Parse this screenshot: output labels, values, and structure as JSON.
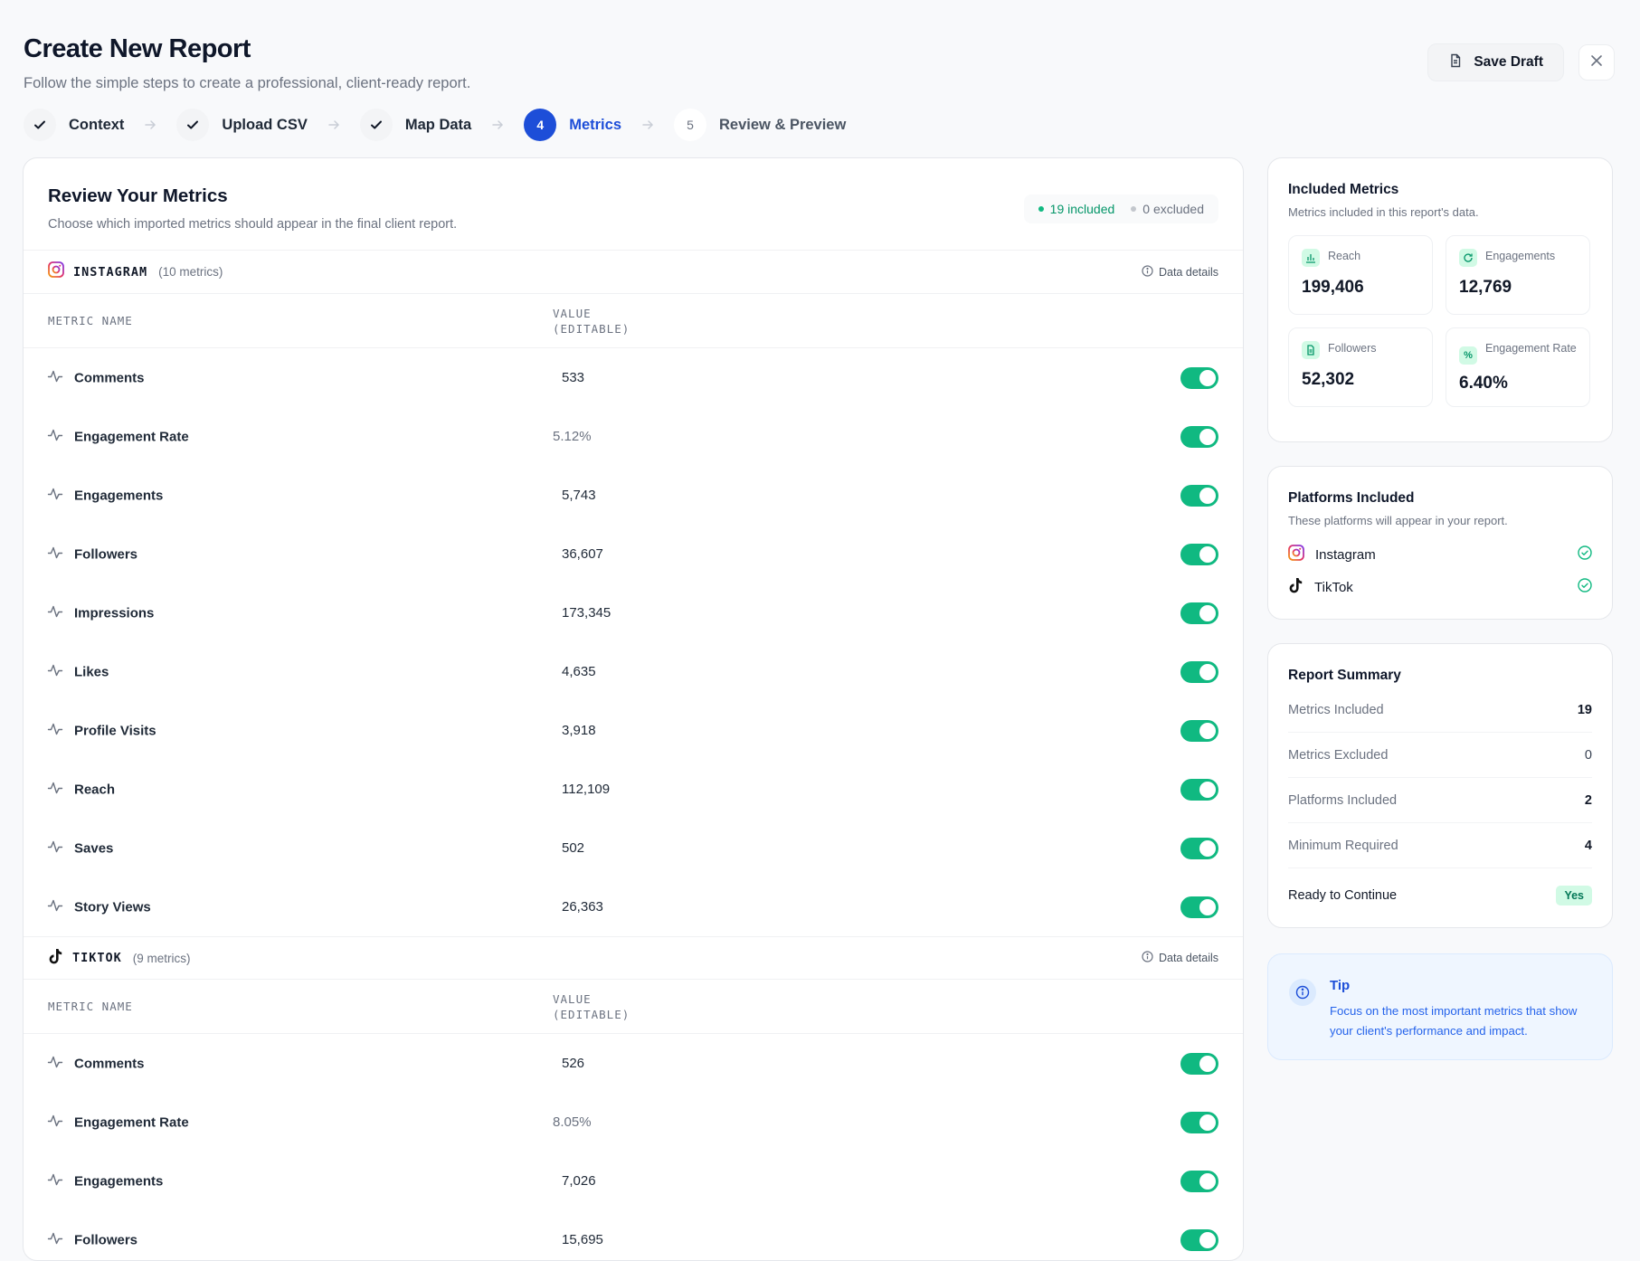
{
  "header": {
    "title": "Create New Report",
    "subtitle": "Follow the simple steps to create a professional, client-ready report.",
    "save_draft": "Save Draft"
  },
  "stepper": {
    "steps": [
      {
        "label": "Context",
        "state": "done"
      },
      {
        "label": "Upload CSV",
        "state": "done"
      },
      {
        "label": "Map Data",
        "state": "done"
      },
      {
        "number": "4",
        "label": "Metrics",
        "state": "active"
      },
      {
        "number": "5",
        "label": "Review & Preview",
        "state": "upcoming"
      }
    ]
  },
  "review": {
    "title": "Review Your Metrics",
    "subtitle": "Choose which imported metrics should appear in the final client report.",
    "included": "19 included",
    "excluded": "0 excluded",
    "col_name": "METRIC NAME",
    "col_value_1": "VALUE",
    "col_value_2": "(EDITABLE)",
    "data_details": "Data details",
    "platforms": [
      {
        "name": "INSTAGRAM",
        "count": "(10 metrics)",
        "metrics": [
          {
            "name": "Comments",
            "value": "533",
            "enabled": true
          },
          {
            "name": "Engagement Rate",
            "value": "5.12%",
            "enabled": true
          },
          {
            "name": "Engagements",
            "value": "5,743",
            "enabled": true
          },
          {
            "name": "Followers",
            "value": "36,607",
            "enabled": true
          },
          {
            "name": "Impressions",
            "value": "173,345",
            "enabled": true
          },
          {
            "name": "Likes",
            "value": "4,635",
            "enabled": true
          },
          {
            "name": "Profile Visits",
            "value": "3,918",
            "enabled": true
          },
          {
            "name": "Reach",
            "value": "112,109",
            "enabled": true
          },
          {
            "name": "Saves",
            "value": "502",
            "enabled": true
          },
          {
            "name": "Story Views",
            "value": "26,363",
            "enabled": true
          }
        ]
      },
      {
        "name": "TIKTOK",
        "count": "(9 metrics)",
        "metrics": [
          {
            "name": "Comments",
            "value": "526",
            "enabled": true
          },
          {
            "name": "Engagement Rate",
            "value": "8.05%",
            "enabled": true
          },
          {
            "name": "Engagements",
            "value": "7,026",
            "enabled": true
          },
          {
            "name": "Followers",
            "value": "15,695",
            "enabled": true
          }
        ]
      }
    ]
  },
  "included_metrics": {
    "title": "Included Metrics",
    "subtitle": "Metrics included in this report's data.",
    "stats": [
      {
        "label": "Reach",
        "value": "199,406",
        "icon": "bar-chart-icon"
      },
      {
        "label": "Engagements",
        "value": "12,769",
        "icon": "refresh-icon"
      },
      {
        "label": "Followers",
        "value": "52,302",
        "icon": "document-icon"
      },
      {
        "label": "Engagement Rate",
        "value": "6.40%",
        "icon": "percent-icon"
      }
    ]
  },
  "platforms_included": {
    "title": "Platforms Included",
    "subtitle": "These platforms will appear in your report.",
    "items": [
      {
        "name": "Instagram",
        "icon": "instagram-icon"
      },
      {
        "name": "TikTok",
        "icon": "tiktok-icon"
      }
    ]
  },
  "report_summary": {
    "title": "Report Summary",
    "rows": [
      {
        "label": "Metrics Included",
        "value": "19"
      },
      {
        "label": "Metrics Excluded",
        "value": "0"
      },
      {
        "label": "Platforms Included",
        "value": "2"
      },
      {
        "label": "Minimum Required",
        "value": "4"
      }
    ],
    "ready_label": "Ready to Continue",
    "ready_value": "Yes"
  },
  "tip": {
    "title": "Tip",
    "text": "Focus on the most important metrics that show your client's performance and impact."
  },
  "colors": {
    "accent": "#1d4ed8",
    "success": "#10b981",
    "instagram": "#e1306c"
  }
}
